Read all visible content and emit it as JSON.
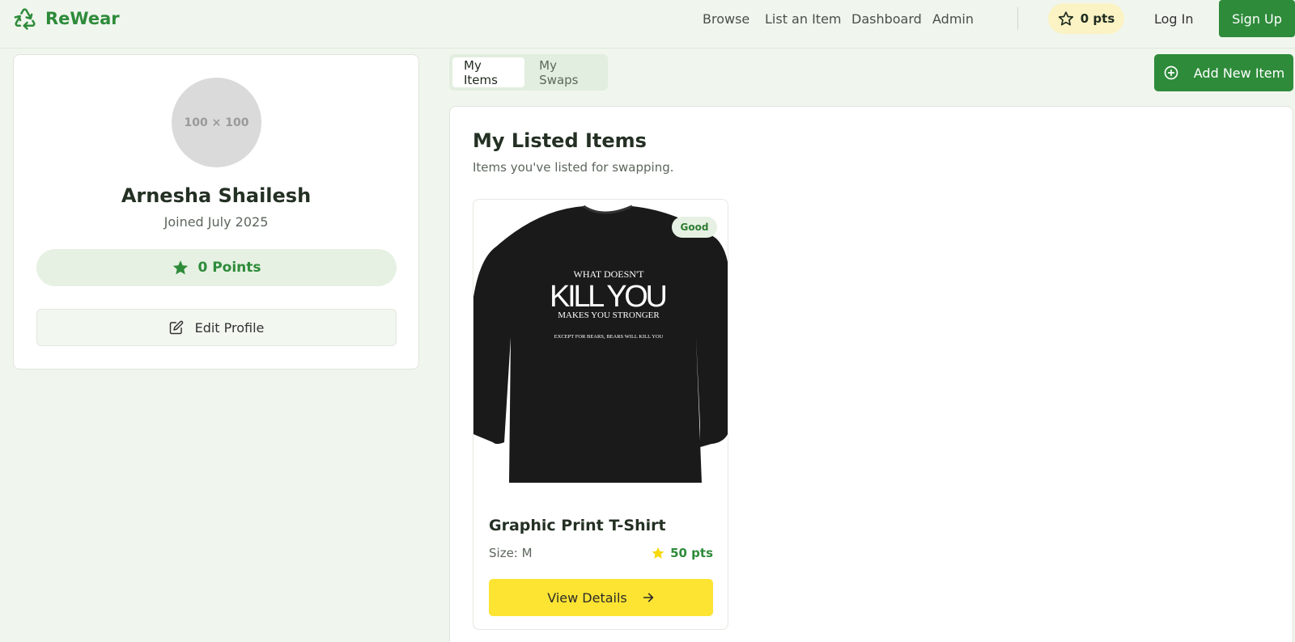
{
  "app": {
    "name": "ReWear"
  },
  "nav": {
    "items": [
      "Browse",
      "List an Item",
      "Dashboard",
      "Admin"
    ],
    "points": "0 pts",
    "login": "Log In",
    "signup": "Sign Up"
  },
  "profile": {
    "avatar_placeholder": "100 × 100",
    "name": "Arnesha Shailesh",
    "joined": "Joined July 2025",
    "points": "0 Points",
    "edit_label": "Edit Profile"
  },
  "tabs": [
    "My Items",
    "My Swaps"
  ],
  "add_item_label": "Add New Item",
  "listing": {
    "title": "My Listed Items",
    "subtitle": "Items you've listed for swapping."
  },
  "items": [
    {
      "title": "Graphic Print T-Shirt",
      "condition": "Good",
      "size": "Size: M",
      "points": "50 pts",
      "view_label": "View Details",
      "print_lines": [
        "WHAT DOESN'T",
        "KILL YOU",
        "MAKES YOU STRONGER",
        "EXCEPT FOR BEARS, BEARS WILL KILL YOU"
      ]
    }
  ],
  "colors": {
    "primary": "#2e8b3a",
    "accent_yellow": "#fde433",
    "background": "#f0f6ee"
  }
}
